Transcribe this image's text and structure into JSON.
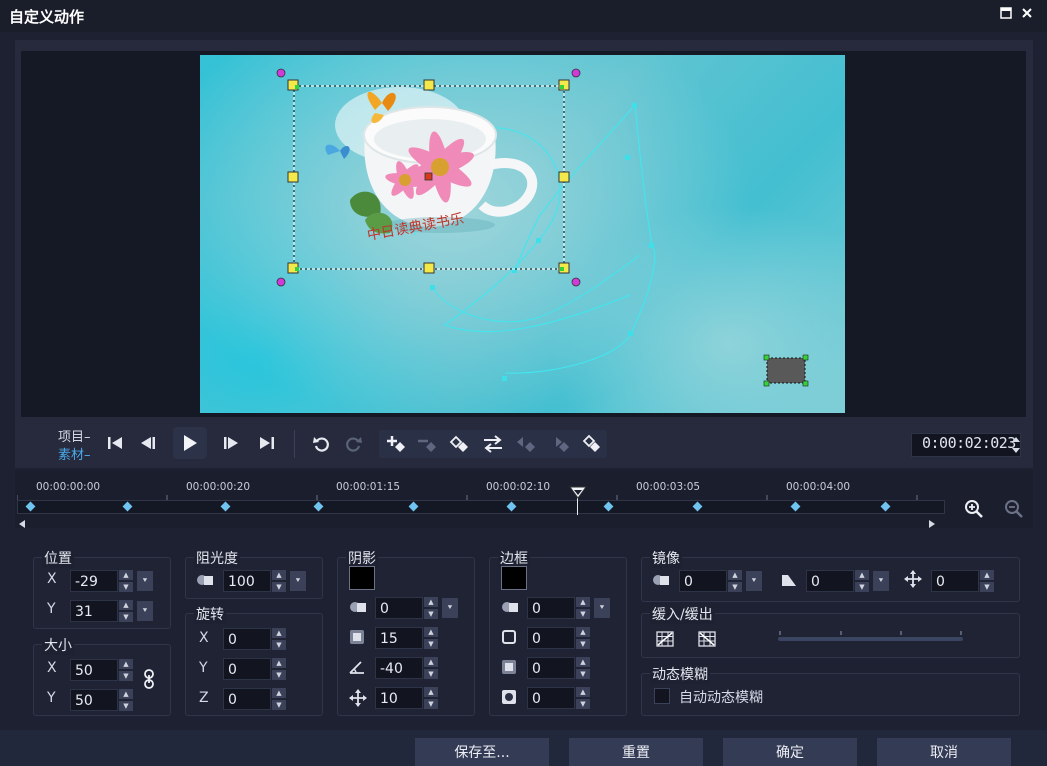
{
  "window": {
    "title": "自定义动作",
    "maximize_icon": "maximize-icon",
    "close_icon": "close-icon"
  },
  "preview": {
    "canvas_caption": "中日读典读书乐"
  },
  "transport": {
    "project_label": "项目",
    "clip_label": "素材",
    "timecode": "0:00:02:023"
  },
  "timeline": {
    "ticks": [
      "00:00:00:00",
      "00:00:00:20",
      "00:00:01:15",
      "00:00:02:10",
      "00:00:03:05",
      "00:00:04:00"
    ]
  },
  "position": {
    "title": "位置",
    "x_label": "X",
    "x_value": "-29",
    "y_label": "Y",
    "y_value": "31"
  },
  "size": {
    "title": "大小",
    "x_label": "X",
    "x_value": "50",
    "y_label": "Y",
    "y_value": "50"
  },
  "opacity": {
    "title": "阻光度",
    "value": "100"
  },
  "rotation": {
    "title": "旋转",
    "x_label": "X",
    "x_value": "0",
    "y_label": "Y",
    "y_value": "0",
    "z_label": "Z",
    "z_value": "0"
  },
  "shadow": {
    "title": "阴影",
    "color": "#000000",
    "opacity_value": "0",
    "blur_value": "15",
    "angle_value": "-40",
    "distance_value": "10"
  },
  "border": {
    "title": "边框",
    "color": "#000000",
    "opacity_value": "0",
    "width_value": "0",
    "blur_value": "0",
    "inner_value": "0"
  },
  "mirror": {
    "title": "镜像",
    "opacity_value": "0",
    "angle_value": "0",
    "distance_value": "0"
  },
  "ease": {
    "title": "缓入/缓出"
  },
  "motion_blur": {
    "title": "动态模糊",
    "auto_label": "自动动态模糊"
  },
  "footer": {
    "save_label": "保存至...",
    "reset_label": "重置",
    "ok_label": "确定",
    "cancel_label": "取消"
  }
}
